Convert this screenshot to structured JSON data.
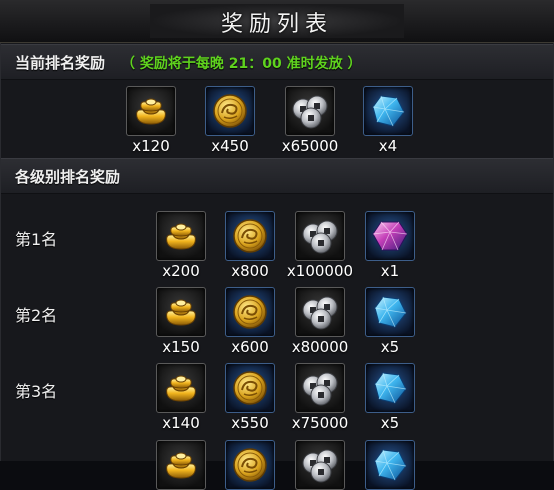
{
  "title": "奖励列表",
  "current": {
    "heading": "当前排名奖励",
    "note": "（ 奖励将于每晚 21：00 准时发放 ）",
    "rewards": [
      {
        "icon": "gold-ingot-icon",
        "qty": "x120"
      },
      {
        "icon": "gold-coin-icon",
        "qty": "x450"
      },
      {
        "icon": "silver-coins-icon",
        "qty": "x65000"
      },
      {
        "icon": "blue-gem-icon",
        "qty": "x4"
      }
    ]
  },
  "tiers": {
    "heading": "各级别排名奖励",
    "ranks": [
      {
        "label": "第1名",
        "rewards": [
          {
            "icon": "gold-ingot-icon",
            "qty": "x200"
          },
          {
            "icon": "gold-coin-icon",
            "qty": "x800"
          },
          {
            "icon": "silver-coins-icon",
            "qty": "x100000"
          },
          {
            "icon": "purple-gem-icon",
            "qty": "x1"
          }
        ]
      },
      {
        "label": "第2名",
        "rewards": [
          {
            "icon": "gold-ingot-icon",
            "qty": "x150"
          },
          {
            "icon": "gold-coin-icon",
            "qty": "x600"
          },
          {
            "icon": "silver-coins-icon",
            "qty": "x80000"
          },
          {
            "icon": "blue-gem-icon",
            "qty": "x5"
          }
        ]
      },
      {
        "label": "第3名",
        "rewards": [
          {
            "icon": "gold-ingot-icon",
            "qty": "x140"
          },
          {
            "icon": "gold-coin-icon",
            "qty": "x550"
          },
          {
            "icon": "silver-coins-icon",
            "qty": "x75000"
          },
          {
            "icon": "blue-gem-icon",
            "qty": "x5"
          }
        ]
      }
    ]
  }
}
